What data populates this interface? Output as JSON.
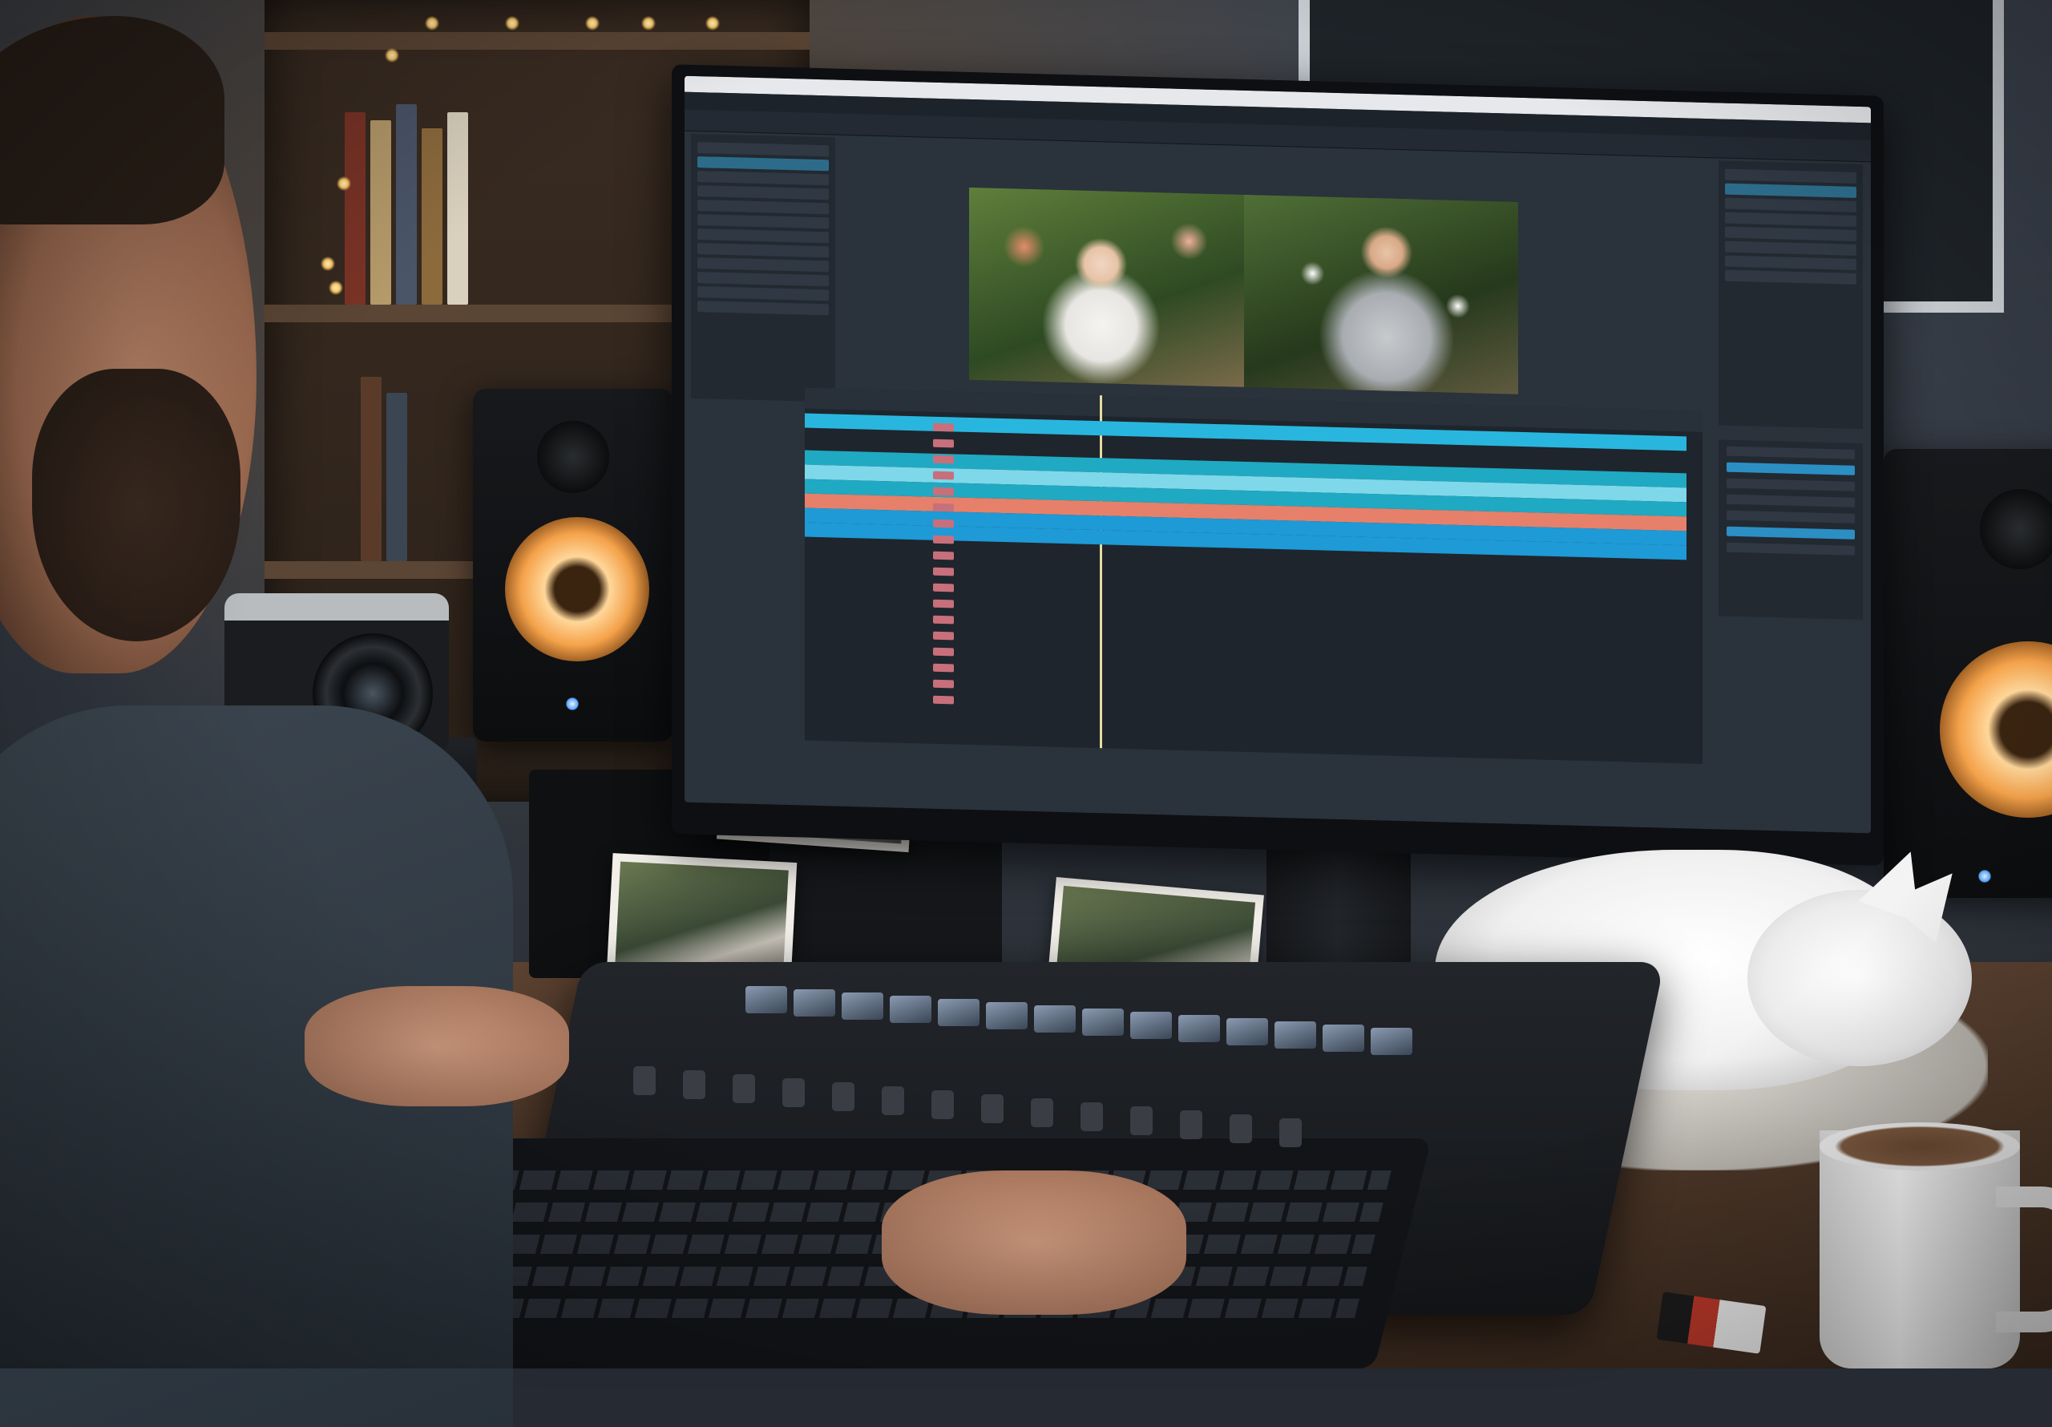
{
  "scene": {
    "description_tag": "video-editing-workstation-photo",
    "screen_app": {
      "titlebar_text": "",
      "menu_items": []
    }
  },
  "colors": {
    "track_cyan": "#29b6de",
    "track_light_cyan": "#7fd8ea",
    "track_teal": "#20a9c2",
    "track_coral": "#e6806a",
    "track_blue": "#1e9ad6",
    "speaker_glow": "#f5a24a",
    "playhead": "#e8dca0"
  },
  "timeline": {
    "tracks": [
      {
        "color_key": "track_cyan"
      },
      {
        "color_key": "track_teal"
      },
      {
        "color_key": "track_light_cyan"
      },
      {
        "color_key": "track_teal"
      },
      {
        "color_key": "track_coral"
      },
      {
        "color_key": "track_blue"
      },
      {
        "color_key": "track_blue"
      }
    ]
  }
}
